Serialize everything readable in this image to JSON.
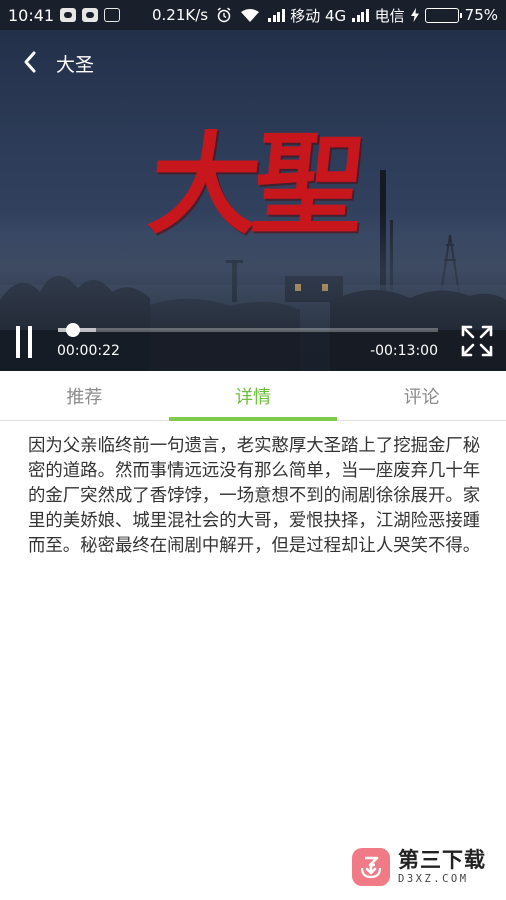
{
  "status_bar": {
    "time": "10:41",
    "network_speed": "0.21K/s",
    "carrier1": "移动 4G",
    "carrier2": "电信",
    "battery_level": "75%",
    "battery_fraction": 0.75
  },
  "video": {
    "header_title": "大圣",
    "title_art_text": "大聖",
    "current_time": "00:00:22",
    "remaining_time": "-00:13:00",
    "progress_fraction": 0.04,
    "buffer_fraction": 0.1
  },
  "tabs": [
    {
      "label": "推荐",
      "active": false
    },
    {
      "label": "详情",
      "active": true
    },
    {
      "label": "评论",
      "active": false
    }
  ],
  "description": "因为父亲临终前一句遗言，老实憨厚大圣踏上了挖掘金厂秘密的道路。然而事情远远没有那么简单，当一座废弃几十年的金厂突然成了香饽饽，一场意想不到的闹剧徐徐展开。家里的美娇娘、城里混社会的大哥，爱恨抉择，江湖险恶接踵而至。秘密最终在闹剧中解开，但是过程却让人哭笑不得。",
  "watermark": {
    "name": "第三下载",
    "domain": "D3XZ.COM"
  },
  "colors": {
    "accent": "#7fcb4f",
    "title_red": "#c8161d",
    "status_bar": "#1a1f2c"
  }
}
